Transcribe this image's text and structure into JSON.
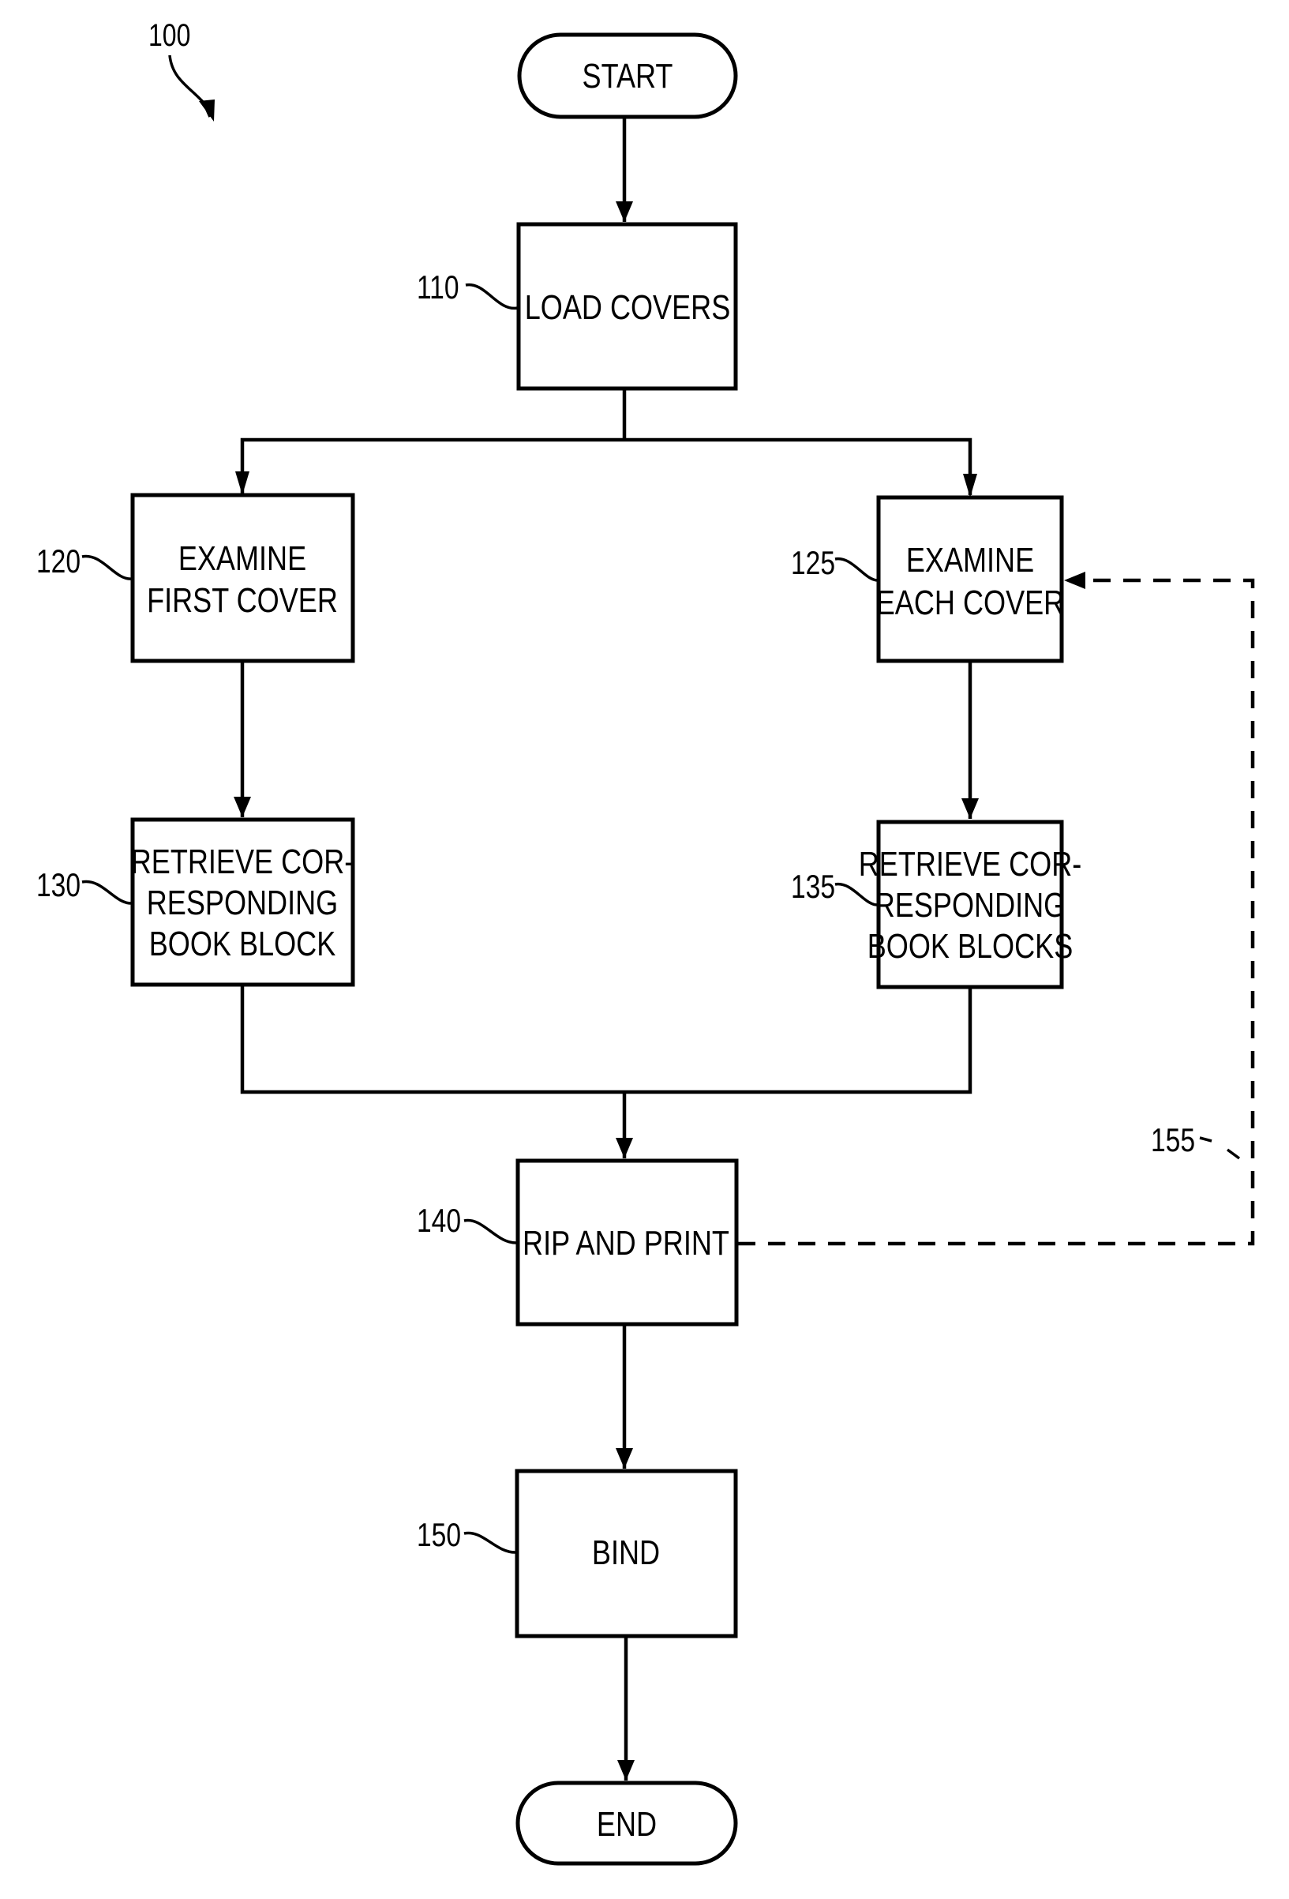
{
  "figure": {
    "reference_numeral": "100",
    "feedback_reference": "155"
  },
  "nodes": {
    "start": {
      "text": [
        "START"
      ]
    },
    "load_covers": {
      "ref": "110",
      "text": [
        "LOAD COVERS"
      ]
    },
    "examine_first": {
      "ref": "120",
      "text": [
        "EXAMINE",
        "FIRST COVER"
      ]
    },
    "examine_each": {
      "ref": "125",
      "text": [
        "EXAMINE",
        "EACH COVER"
      ]
    },
    "retrieve_block": {
      "ref": "130",
      "text": [
        "RETRIEVE COR-",
        "RESPONDING",
        "BOOK BLOCK"
      ]
    },
    "retrieve_blocks": {
      "ref": "135",
      "text": [
        "RETRIEVE COR-",
        "RESPONDING",
        "BOOK BLOCKS"
      ]
    },
    "rip_print": {
      "ref": "140",
      "text": [
        "RIP AND PRINT"
      ]
    },
    "bind": {
      "ref": "150",
      "text": [
        "BIND"
      ]
    },
    "end": {
      "text": [
        "END"
      ]
    }
  },
  "colors": {
    "ink": "#000000",
    "paper": "#ffffff"
  }
}
